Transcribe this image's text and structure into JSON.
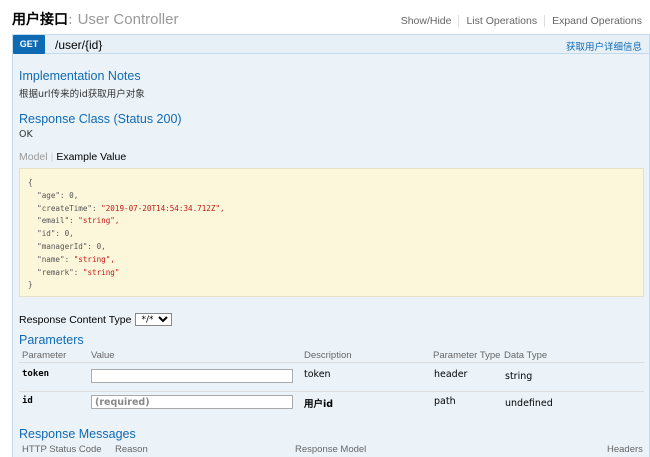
{
  "controller": {
    "title_cn": "用户接口",
    "separator": ":",
    "name": "User Controller"
  },
  "operations": [
    {
      "label": "Show/Hide"
    },
    {
      "label": "List Operations"
    },
    {
      "label": "Expand Operations"
    }
  ],
  "endpoint": {
    "method": "GET",
    "path": "/user/{id}",
    "summary": "获取用户详细信息",
    "implementation_notes_heading": "Implementation Notes",
    "implementation_notes": "根据url传来的id获取用户对象",
    "response_class_heading": "Response Class (Status 200)",
    "response_class_value": "OK",
    "model_tab": "Model",
    "tab_separator": "|",
    "example_tab": "Example Value",
    "example_json": [
      {
        "key": "{",
        "value": ""
      },
      {
        "key": "  \"age\": ",
        "value": "0,"
      },
      {
        "key": "  \"createTime\": ",
        "value": "\"2019-07-20T14:54:34.712Z\","
      },
      {
        "key": "  \"email\": ",
        "value": "\"string\","
      },
      {
        "key": "  \"id\": ",
        "value": "0,"
      },
      {
        "key": "  \"managerId\": ",
        "value": "0,"
      },
      {
        "key": "  \"name\": ",
        "value": "\"string\","
      },
      {
        "key": "  \"remark\": ",
        "value": "\"string\""
      },
      {
        "key": "}",
        "value": ""
      }
    ],
    "response_content_type_label": "Response Content Type",
    "response_content_type_value": "*/*",
    "parameters_heading": "Parameters",
    "param_columns": [
      "Parameter",
      "Value",
      "Description",
      "Parameter Type",
      "Data Type"
    ],
    "params": [
      {
        "name": "token",
        "value": "",
        "placeholder": "",
        "description": "token",
        "param_type": "header",
        "data_type": "string"
      },
      {
        "name": "id",
        "value": "",
        "placeholder": "(required)",
        "description": "用户id",
        "param_type": "path",
        "data_type": "undefined"
      }
    ],
    "response_messages_heading": "Response Messages",
    "response_columns": [
      "HTTP Status Code",
      "Reason",
      "Response Model",
      "Headers"
    ]
  },
  "colors": {
    "get_blue": "#0f6ab4",
    "endpoint_bg": "#ebf3f9",
    "snippet_bg": "#fcf6db",
    "string_red": "#c41a16"
  }
}
